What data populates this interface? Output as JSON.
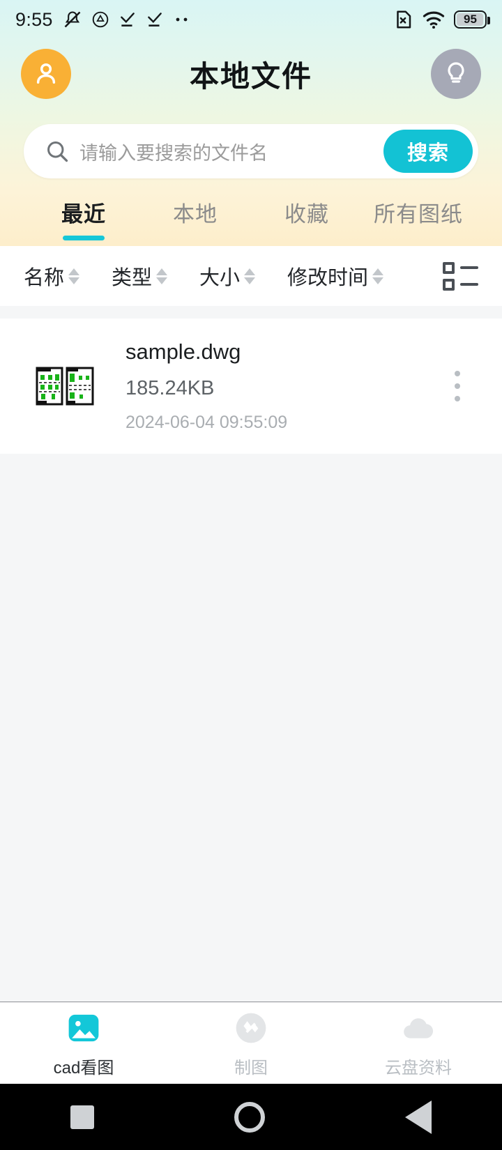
{
  "status_bar": {
    "time": "9:55",
    "left_icons": [
      "mute-icon",
      "drive-icon",
      "download-done-icon",
      "download-done-icon",
      "more-icon"
    ],
    "right_icons": [
      "no-sim-icon",
      "wifi-icon"
    ],
    "battery_level": "95"
  },
  "header": {
    "title": "本地文件",
    "avatar_icon": "user-avatar-icon",
    "bulb_icon": "lightbulb-icon",
    "avatar_color": "#f9b035",
    "bulb_color": "#a6a9b6"
  },
  "search": {
    "placeholder": "请输入要搜索的文件名",
    "value": "",
    "button_label": "搜索",
    "button_color": "#13c2d4",
    "icon": "search-icon"
  },
  "tabs": [
    {
      "label": "最近",
      "active": true
    },
    {
      "label": "本地",
      "active": false
    },
    {
      "label": "收藏",
      "active": false
    },
    {
      "label": "所有图纸",
      "active": false
    }
  ],
  "tab_accent_color": "#16c7d8",
  "sort_bar": {
    "columns": [
      {
        "label": "名称",
        "sortable": true
      },
      {
        "label": "类型",
        "sortable": true
      },
      {
        "label": "大小",
        "sortable": true
      },
      {
        "label": "修改时间",
        "sortable": true
      }
    ],
    "view_toggle_icon": "list-view-icon"
  },
  "file_list": [
    {
      "name": "sample.dwg",
      "size": "185.24KB",
      "modified": "2024-06-04 09:55:09",
      "thumbnail_icon": "cad-drawing-thumbnail",
      "more_icon": "more-vertical-icon"
    }
  ],
  "bottom_nav": [
    {
      "label": "cad看图",
      "icon": "image-icon",
      "active": true
    },
    {
      "label": "制图",
      "icon": "draw-icon",
      "active": false
    },
    {
      "label": "云盘资料",
      "icon": "cloud-icon",
      "active": false
    }
  ],
  "system_nav": {
    "recent_icon": "square-icon",
    "home_icon": "circle-icon",
    "back_icon": "triangle-back-icon"
  }
}
